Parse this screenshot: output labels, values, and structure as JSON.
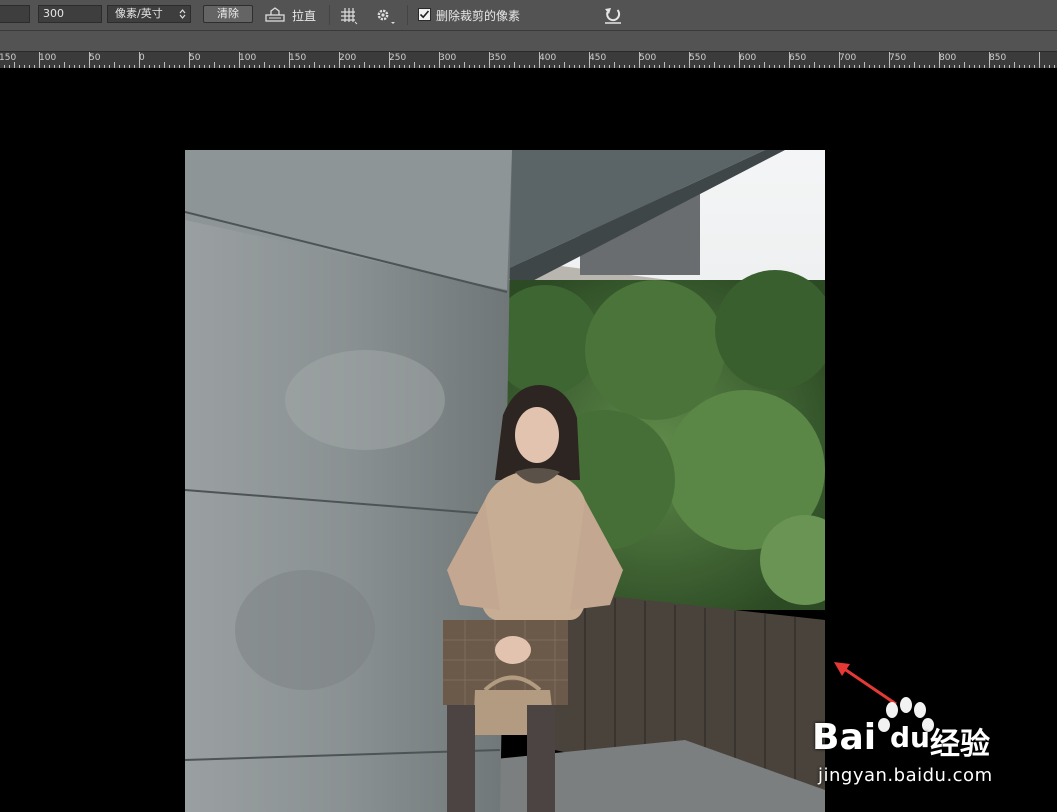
{
  "options_bar": {
    "resolution_value": "300",
    "resolution_unit": "像素/英寸",
    "clear_button": "清除",
    "straighten_label": "拉直",
    "delete_cropped_label": "删除裁剪的像素",
    "delete_cropped_checked": true
  },
  "ruler": {
    "ticks": [
      "150",
      "100",
      "50",
      "0",
      "50",
      "100",
      "150",
      "200",
      "250",
      "300",
      "350",
      "400",
      "450",
      "500",
      "550",
      "600",
      "650",
      "700",
      "750",
      "800",
      "850"
    ]
  },
  "watermark": {
    "logo_text_bai": "Bai",
    "logo_text_du": "du",
    "logo_text_cn": "经验",
    "url": "jingyan.baidu.com"
  },
  "colors": {
    "toolbar": "#535353",
    "canvas": "#000000",
    "annotation_arrow": "#e53935"
  },
  "icons": [
    "straighten-icon",
    "grid-overlay-icon",
    "gear-icon",
    "checkbox-icon",
    "undo-rotate-icon",
    "dropdown-arrow-icon"
  ]
}
